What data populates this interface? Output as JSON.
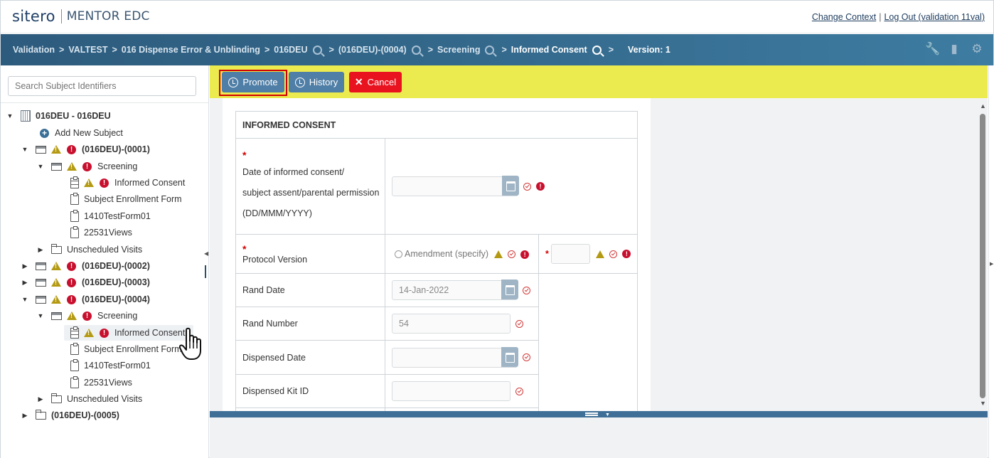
{
  "header": {
    "logo_brand": "sitero",
    "logo_product": "MENTOR EDC",
    "change_context": "Change Context",
    "separator": "|",
    "logout": "Log Out (validation 11val)"
  },
  "breadcrumb": {
    "items": [
      "Validation",
      "VALTEST",
      "016 Dispense Error & Unblinding",
      "016DEU",
      "(016DEU)-(0004)",
      "Screening",
      "Informed Consent"
    ],
    "gt": ">",
    "version": "Version: 1"
  },
  "sidebar": {
    "search_placeholder": "Search Subject Identifiers",
    "tree": {
      "root": "016DEU - 016DEU",
      "add_subject": "Add New Subject",
      "subject1": "(016DEU)-(0001)",
      "s1_screening": "Screening",
      "s1_forms": [
        "Informed Consent",
        "Subject Enrollment Form",
        "1410TestForm01",
        "22531Views"
      ],
      "s1_unscheduled": "Unscheduled Visits",
      "subject2": "(016DEU)-(0002)",
      "subject3": "(016DEU)-(0003)",
      "subject4": "(016DEU)-(0004)",
      "s4_screening": "Screening",
      "s4_forms": [
        "Informed Consent",
        "Subject Enrollment Form",
        "1410TestForm01",
        "22531Views"
      ],
      "s4_unscheduled": "Unscheduled Visits",
      "subject5": "(016DEU)-(0005)"
    }
  },
  "toolbar": {
    "promote": "Promote",
    "history": "History",
    "cancel": "Cancel",
    "colors": {
      "bar": "#ebea4f",
      "button_blue": "#4f7ea6",
      "button_red": "#e8131f"
    }
  },
  "form": {
    "title": "INFORMED CONSENT",
    "required_mark": "*",
    "consent_date": {
      "label_lines": [
        "Date of informed consent/",
        "subject assent/parental permission",
        "(DD/MMM/YYYY)"
      ],
      "value": ""
    },
    "protocol_version": {
      "label": "Protocol Version",
      "radio_option": "Amendment (specify)",
      "specify_value": ""
    },
    "rand_date": {
      "label": "Rand Date",
      "value": "14-Jan-2022"
    },
    "rand_number": {
      "label": "Rand Number",
      "value": "54"
    },
    "dispensed_date": {
      "label": "Dispensed Date",
      "value": ""
    },
    "dispensed_kit_id": {
      "label": "Dispensed Kit ID",
      "value": ""
    }
  }
}
